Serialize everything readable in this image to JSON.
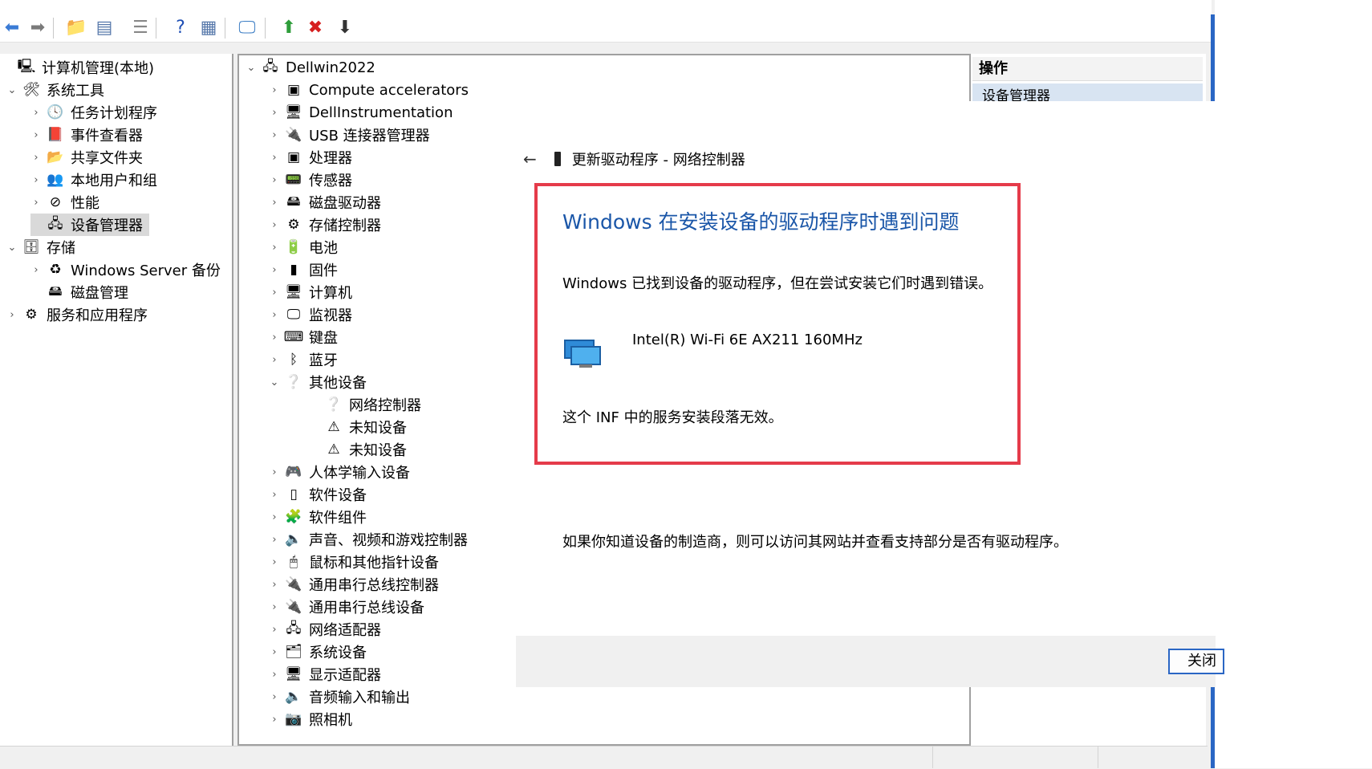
{
  "toolbar": {
    "buttons": [
      {
        "name": "back-icon",
        "glyph": "⬅",
        "color": "#3a7bd5"
      },
      {
        "name": "forward-icon",
        "glyph": "➡",
        "color": "#7a7a7a"
      },
      {
        "name": "up-folder-icon",
        "glyph": "📁",
        "color": "#d4a017"
      },
      {
        "name": "show-hide-tree-icon",
        "glyph": "▤",
        "color": "#5577aa"
      },
      {
        "name": "properties-icon",
        "glyph": "☰",
        "color": "#888888"
      },
      {
        "name": "help-icon",
        "glyph": "?",
        "color": "#1f4fb5"
      },
      {
        "name": "action-pane-icon",
        "glyph": "▦",
        "color": "#5577aa"
      },
      {
        "name": "scan-hardware-icon",
        "glyph": "🖵",
        "color": "#3b7dc4"
      },
      {
        "name": "enable-device-icon",
        "glyph": "⬆",
        "color": "#2e9d3a"
      },
      {
        "name": "uninstall-device-icon",
        "glyph": "✖",
        "color": "#d61e1e"
      },
      {
        "name": "update-driver-icon",
        "glyph": "⬇",
        "color": "#333333"
      }
    ]
  },
  "left_tree": [
    {
      "label": "计算机管理(本地)",
      "indent": 0,
      "chev": "",
      "icon": "🖳",
      "icon_name": "computer-management-icon"
    },
    {
      "label": "系统工具",
      "indent": 1,
      "chev": "⌄",
      "icon": "🛠",
      "icon_name": "system-tools-icon"
    },
    {
      "label": "任务计划程序",
      "indent": 2,
      "chev": "›",
      "icon": "🕓",
      "icon_name": "task-scheduler-icon"
    },
    {
      "label": "事件查看器",
      "indent": 2,
      "chev": "›",
      "icon": "📕",
      "icon_name": "event-viewer-icon"
    },
    {
      "label": "共享文件夹",
      "indent": 2,
      "chev": "›",
      "icon": "📂",
      "icon_name": "shared-folders-icon"
    },
    {
      "label": "本地用户和组",
      "indent": 2,
      "chev": "›",
      "icon": "👥",
      "icon_name": "local-users-icon"
    },
    {
      "label": "性能",
      "indent": 2,
      "chev": "›",
      "icon": "⊘",
      "icon_name": "performance-icon"
    },
    {
      "label": "设备管理器",
      "indent": 2,
      "chev": "",
      "icon": "🖧",
      "icon_name": "device-manager-icon",
      "selected": true
    },
    {
      "label": "存储",
      "indent": 1,
      "chev": "⌄",
      "icon": "🗄",
      "icon_name": "storage-icon"
    },
    {
      "label": "Windows Server 备份",
      "indent": 2,
      "chev": "›",
      "icon": "♻",
      "icon_name": "server-backup-icon"
    },
    {
      "label": "磁盘管理",
      "indent": 2,
      "chev": "",
      "icon": "🖴",
      "icon_name": "disk-management-icon"
    },
    {
      "label": "服务和应用程序",
      "indent": 1,
      "chev": "›",
      "icon": "⚙",
      "icon_name": "services-apps-icon"
    }
  ],
  "device_tree": [
    {
      "label": "Dellwin2022",
      "indent": 0,
      "chev": "⌄",
      "icon": "🖧",
      "icon_name": "computer-node-icon"
    },
    {
      "label": "Compute accelerators",
      "indent": 1,
      "chev": "›",
      "icon": "▣",
      "icon_name": "compute-accelerators-icon"
    },
    {
      "label": "DellInstrumentation",
      "indent": 1,
      "chev": "›",
      "icon": "🖥",
      "icon_name": "dell-instrumentation-icon"
    },
    {
      "label": "USB 连接器管理器",
      "indent": 1,
      "chev": "›",
      "icon": "🔌",
      "icon_name": "usb-connector-icon"
    },
    {
      "label": "处理器",
      "indent": 1,
      "chev": "›",
      "icon": "▣",
      "icon_name": "processor-icon"
    },
    {
      "label": "传感器",
      "indent": 1,
      "chev": "›",
      "icon": "📟",
      "icon_name": "sensor-icon"
    },
    {
      "label": "磁盘驱动器",
      "indent": 1,
      "chev": "›",
      "icon": "🖴",
      "icon_name": "disk-drive-icon"
    },
    {
      "label": "存储控制器",
      "indent": 1,
      "chev": "›",
      "icon": "⚙",
      "icon_name": "storage-controller-icon"
    },
    {
      "label": "电池",
      "indent": 1,
      "chev": "›",
      "icon": "🔋",
      "icon_name": "battery-icon"
    },
    {
      "label": "固件",
      "indent": 1,
      "chev": "›",
      "icon": "▮",
      "icon_name": "firmware-icon"
    },
    {
      "label": "计算机",
      "indent": 1,
      "chev": "›",
      "icon": "🖥",
      "icon_name": "computer-icon"
    },
    {
      "label": "监视器",
      "indent": 1,
      "chev": "›",
      "icon": "🖵",
      "icon_name": "monitor-icon"
    },
    {
      "label": "键盘",
      "indent": 1,
      "chev": "›",
      "icon": "⌨",
      "icon_name": "keyboard-icon"
    },
    {
      "label": "蓝牙",
      "indent": 1,
      "chev": "›",
      "icon": "ᛒ",
      "icon_name": "bluetooth-icon"
    },
    {
      "label": "其他设备",
      "indent": 1,
      "chev": "⌄",
      "icon": "❔",
      "icon_name": "other-devices-icon"
    },
    {
      "label": "网络控制器",
      "indent": 2,
      "chev": "",
      "icon": "❔",
      "icon_name": "network-controller-icon"
    },
    {
      "label": "未知设备",
      "indent": 2,
      "chev": "",
      "icon": "⚠",
      "icon_name": "unknown-device-warning-icon"
    },
    {
      "label": "未知设备",
      "indent": 2,
      "chev": "",
      "icon": "⚠",
      "icon_name": "unknown-device-warning-icon"
    },
    {
      "label": "人体学输入设备",
      "indent": 1,
      "chev": "›",
      "icon": "🎮",
      "icon_name": "hid-icon"
    },
    {
      "label": "软件设备",
      "indent": 1,
      "chev": "›",
      "icon": "▯",
      "icon_name": "software-device-icon"
    },
    {
      "label": "软件组件",
      "indent": 1,
      "chev": "›",
      "icon": "🧩",
      "icon_name": "software-component-icon"
    },
    {
      "label": "声音、视频和游戏控制器",
      "indent": 1,
      "chev": "›",
      "icon": "🔈",
      "icon_name": "sound-icon"
    },
    {
      "label": "鼠标和其他指针设备",
      "indent": 1,
      "chev": "›",
      "icon": "🖱",
      "icon_name": "mouse-icon"
    },
    {
      "label": "通用串行总线控制器",
      "indent": 1,
      "chev": "›",
      "icon": "🔌",
      "icon_name": "usb-controller-icon"
    },
    {
      "label": "通用串行总线设备",
      "indent": 1,
      "chev": "›",
      "icon": "🔌",
      "icon_name": "usb-device-icon"
    },
    {
      "label": "网络适配器",
      "indent": 1,
      "chev": "›",
      "icon": "🖧",
      "icon_name": "network-adapter-icon"
    },
    {
      "label": "系统设备",
      "indent": 1,
      "chev": "›",
      "icon": "🗂",
      "icon_name": "system-devices-icon"
    },
    {
      "label": "显示适配器",
      "indent": 1,
      "chev": "›",
      "icon": "🖥",
      "icon_name": "display-adapter-icon"
    },
    {
      "label": "音频输入和输出",
      "indent": 1,
      "chev": "›",
      "icon": "🔈",
      "icon_name": "audio-io-icon"
    },
    {
      "label": "照相机",
      "indent": 1,
      "chev": "›",
      "icon": "📷",
      "icon_name": "camera-icon"
    }
  ],
  "actions": {
    "header": "操作",
    "sub": "设备管理器"
  },
  "dialog": {
    "back": "←",
    "title": "更新驱动程序 - 网络控制器",
    "error_title": "Windows 在安装设备的驱动程序时遇到问题",
    "error_message": "Windows 已找到设备的驱动程序，但在尝试安装它们时遇到错误。",
    "device_name": "Intel(R) Wi-Fi 6E AX211 160MHz",
    "inf_message": "这个 INF 中的服务安装段落无效。",
    "hint": "如果你知道设备的制造商，则可以访问其网站并查看支持部分是否有驱动程序。",
    "close_label": "关闭"
  },
  "colors": {
    "accent": "#2a66c4",
    "error_border": "#e53b4a",
    "error_title": "#1a56a8"
  }
}
